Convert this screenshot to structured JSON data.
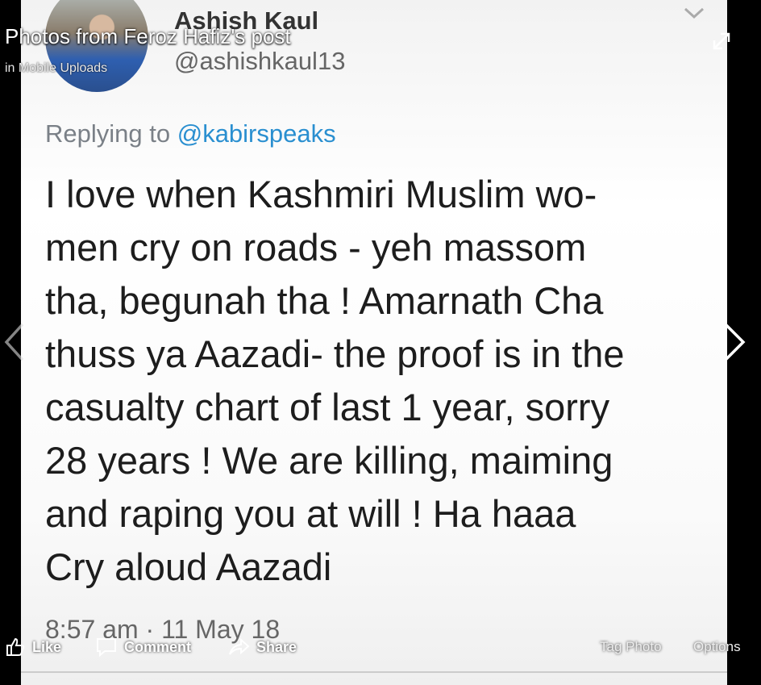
{
  "viewer": {
    "title": "Photos from Feroz Hafiz's post",
    "subtitle": "in Mobile Uploads"
  },
  "tweet": {
    "author_name": "Ashish Kaul",
    "author_handle": "@ashishkaul13",
    "replying_prefix": "Replying to",
    "replying_handle": "@kabirspeaks",
    "text_lines": [
      "I love when Kashmiri Muslim wo-",
      "men cry on roads - yeh massom",
      "tha, begunah tha !  Amarnath Cha",
      "thuss ya Aazadi- the proof is in the",
      "casualty chart of last 1 year, sorry",
      "28 years ! We are killing, maiming",
      "and raping you at will ! Ha haaa",
      "Cry aloud Aazadi"
    ],
    "timestamp": "8:57 am · 11 May 18"
  },
  "actions": {
    "like": "Like",
    "comment": "Comment",
    "share": "Share",
    "tag_photo": "Tag Photo",
    "options": "Options"
  },
  "icons": {
    "like": "thumbs-up-icon",
    "comment": "speech-bubble-icon",
    "share": "share-arrow-icon",
    "expand": "expand-arrows-icon",
    "prev": "chevron-left-icon",
    "next": "chevron-right-icon",
    "menu": "chevron-down-icon"
  },
  "colors": {
    "link_blue": "#2a8fd0",
    "text_dark": "#1d1d1d"
  }
}
